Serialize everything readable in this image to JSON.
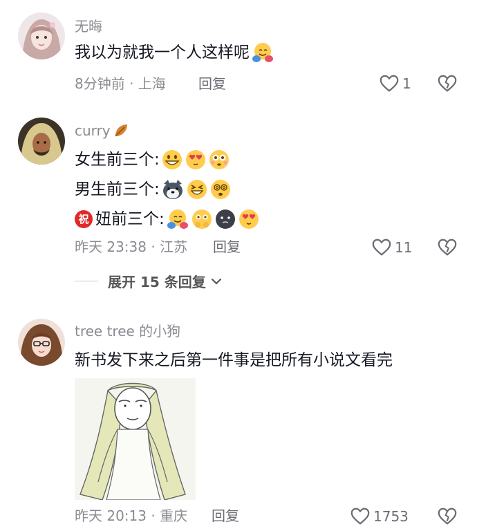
{
  "comments": [
    {
      "author": "无晦",
      "text": "我以为就我一个人这样呢",
      "time": "8分钟前 · 上海",
      "reply_label": "回复",
      "likes": "1"
    },
    {
      "author": "curry",
      "lines": [
        "女生前三个:",
        "男生前三个:",
        "妞前三个:"
      ],
      "badge": "祝",
      "time": "昨天 23:38 · 江苏",
      "reply_label": "回复",
      "likes": "11",
      "expand_label": "展开 15 条回复"
    },
    {
      "author": "tree tree 的小狗",
      "text": "新书发下来之后第一件事是把所有小说文看完",
      "time": "昨天 20:13 · 重庆",
      "reply_label": "回复",
      "likes": "1753"
    }
  ],
  "icons": {
    "like": "heart-outline-icon",
    "dislike": "broken-heart-icon",
    "expand": "chevron-down-icon"
  },
  "colors": {
    "meta": "#8a8b91",
    "text": "#161823"
  }
}
